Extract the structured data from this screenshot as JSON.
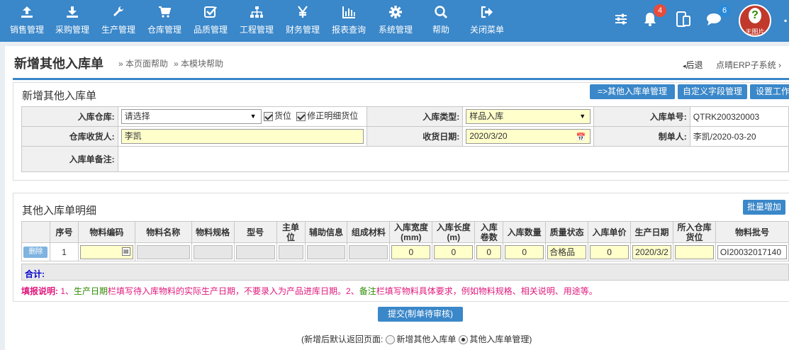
{
  "nav": {
    "items": [
      {
        "label": "销售管理",
        "icon": "upload-icon"
      },
      {
        "label": "采购管理",
        "icon": "download-icon"
      },
      {
        "label": "生产管理",
        "icon": "wrench-icon"
      },
      {
        "label": "仓库管理",
        "icon": "cart-icon"
      },
      {
        "label": "品质管理",
        "icon": "checkbox-icon"
      },
      {
        "label": "工程管理",
        "icon": "sitemap-icon"
      },
      {
        "label": "财务管理",
        "icon": "yen-icon"
      },
      {
        "label": "报表查询",
        "icon": "bar-chart-icon"
      },
      {
        "label": "系统管理",
        "icon": "gear-icon"
      },
      {
        "label": "帮助",
        "icon": "search-icon"
      },
      {
        "label": "关闭菜单",
        "icon": "exit-icon"
      }
    ],
    "notifications_count": "4",
    "messages_count": "6",
    "avatar_text": "无图片",
    "avatar_mark": "?"
  },
  "header": {
    "title": "新增其他入库单",
    "help_page": "» 本页面帮助",
    "help_module": "» 本模块帮助",
    "back": "后退",
    "breadcrumb": "点晴ERP子系统 ›"
  },
  "form": {
    "panel_title": "新增其他入库单",
    "buttons": {
      "manage": "=>其他入库单管理",
      "custom_fields": "自定义字段管理",
      "settings": "设置工作"
    },
    "warehouse_label": "入库仓库:",
    "warehouse_value": "请选择",
    "location_check": "货位",
    "fix_location_check": "修正明细货位",
    "type_label": "入库类型:",
    "type_value": "样品入库",
    "number_label": "入库单号:",
    "number_value": "QTRK200320003",
    "receiver_label": "仓库收货人:",
    "receiver_value": "李凯",
    "date_label": "收货日期:",
    "date_value": "2020/3/20",
    "maker_label": "制单人:",
    "maker_value": "李凯/2020-03-20",
    "remark_label": "入库单备注:"
  },
  "detail": {
    "panel_title": "其他入库单明细",
    "batch_add": "批量增加",
    "columns": [
      "",
      "序号",
      "物料编码",
      "物料名称",
      "物料规格",
      "型号",
      "主单位",
      "辅助信息",
      "组成材料",
      "入库宽度(mm)",
      "入库长度(m)",
      "入库卷数",
      "入库数量",
      "质量状态",
      "入库单价",
      "生产日期",
      "所入仓库货位",
      "物料批号"
    ],
    "row": {
      "delete": "删除",
      "seq": "1",
      "width": "0",
      "length": "0",
      "rolls": "0",
      "qty": "0",
      "quality": "合格品",
      "price": "0",
      "prod_date": "2020/3/2",
      "batch_no": "OI20032017140"
    },
    "total_label": "合计:"
  },
  "note": {
    "head": "填报说明:",
    "p1": "1、",
    "g1": "生产日期",
    "p2": "栏填写待入库物料的实际生产日期，不要录入为产品进库日期。2、",
    "g2": "备注",
    "p3": "栏填写物料具体要求，例如物料规格、相关说明、用途等。"
  },
  "submit_label": "提交(制单待审核)",
  "after_save": {
    "label": "(新增后默认返回页面:",
    "opt1": "新增其他入库单",
    "opt2": "其他入库单管理)"
  }
}
